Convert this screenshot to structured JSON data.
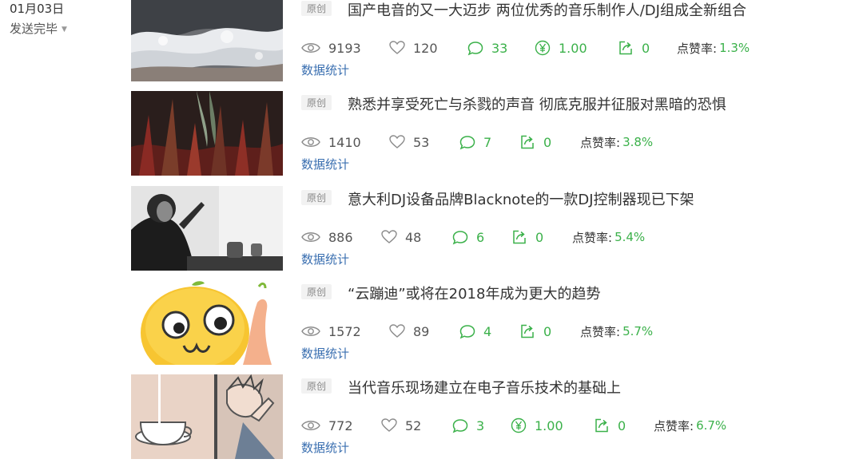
{
  "header": {
    "date": "01月03日",
    "status": "发送完毕"
  },
  "articles": [
    {
      "badge": "原创",
      "title": "国产电音的又一大迈步 两位优秀的音乐制作人/DJ组成全新组合",
      "views": "9193",
      "likes": "120",
      "comments": "33",
      "reward": "1.00",
      "shares": "0",
      "like_rate_label": "点赞率:",
      "like_rate": "1.3%",
      "stats_link": "数据统计"
    },
    {
      "badge": "原创",
      "title": "熟悉并享受死亡与杀戮的声音 彻底克服并征服对黑暗的恐惧",
      "views": "1410",
      "likes": "53",
      "comments": "7",
      "shares": "0",
      "like_rate_label": "点赞率:",
      "like_rate": "3.8%",
      "stats_link": "数据统计"
    },
    {
      "badge": "原创",
      "title": "意大利DJ设备品牌Blacknote的一款DJ控制器现已下架",
      "views": "886",
      "likes": "48",
      "comments": "6",
      "shares": "0",
      "like_rate_label": "点赞率:",
      "like_rate": "5.4%",
      "stats_link": "数据统计"
    },
    {
      "badge": "原创",
      "title": "“云蹦迪”或将在2018年成为更大的趋势",
      "views": "1572",
      "likes": "89",
      "comments": "4",
      "shares": "0",
      "like_rate_label": "点赞率:",
      "like_rate": "5.7%",
      "stats_link": "数据统计"
    },
    {
      "badge": "原创",
      "title": "当代音乐现场建立在电子音乐技术的基础上",
      "views": "772",
      "likes": "52",
      "comments": "3",
      "reward": "1.00",
      "shares": "0",
      "like_rate_label": "点赞率:",
      "like_rate": "6.7%",
      "stats_link": "数据统计"
    }
  ],
  "icons": {
    "views": "eye-icon",
    "likes": "heart-icon",
    "comments": "comment-bubble-icon",
    "reward": "yen-reward-icon",
    "shares": "share-icon"
  },
  "colors": {
    "accent_green": "#3bb14a",
    "link_blue": "#3a6fb0",
    "badge_bg": "#f2f2f2"
  }
}
